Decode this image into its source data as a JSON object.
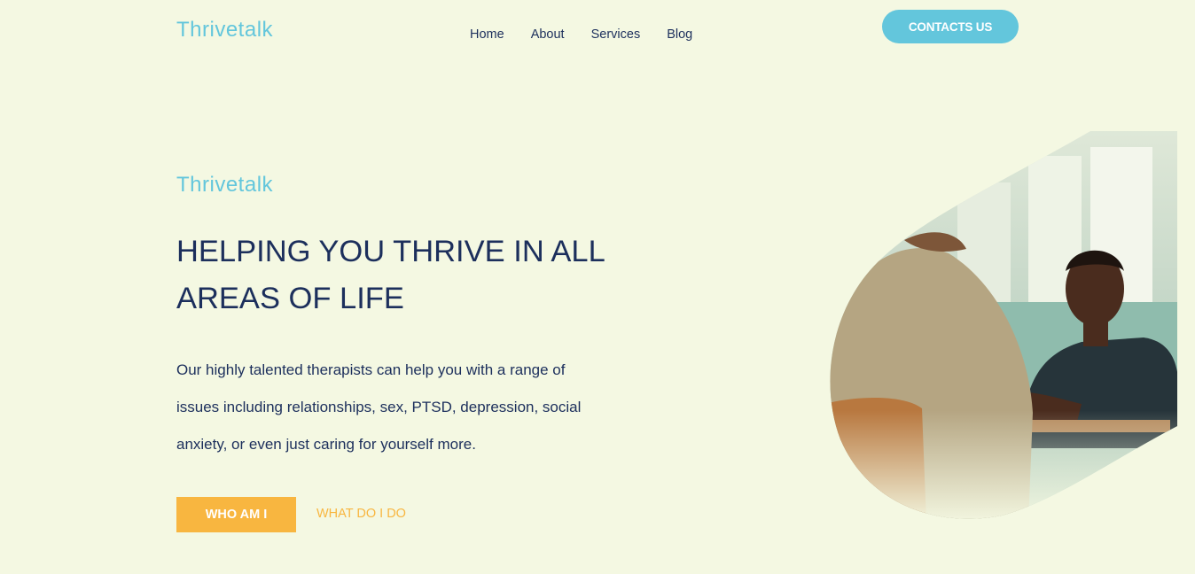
{
  "header": {
    "logo": "Thrivetalk",
    "nav": [
      "Home",
      "About",
      "Services",
      "Blog"
    ],
    "contact_label": "CONTACTS US"
  },
  "hero": {
    "eyebrow": "Thrivetalk",
    "headline": "HELPING YOU THRIVE IN ALL AREAS OF LIFE",
    "description": "Our highly talented therapists can help you with a range of issues including relationships, sex, PTSD, depression, social anxiety, or even just caring for yourself more.",
    "primary_button": "WHO AM I",
    "secondary_button": "WHAT DO I DO"
  },
  "colors": {
    "background": "#f4f8e2",
    "accent_blue": "#63c6dc",
    "navy": "#1c2f5c",
    "accent_orange": "#f8b640"
  }
}
